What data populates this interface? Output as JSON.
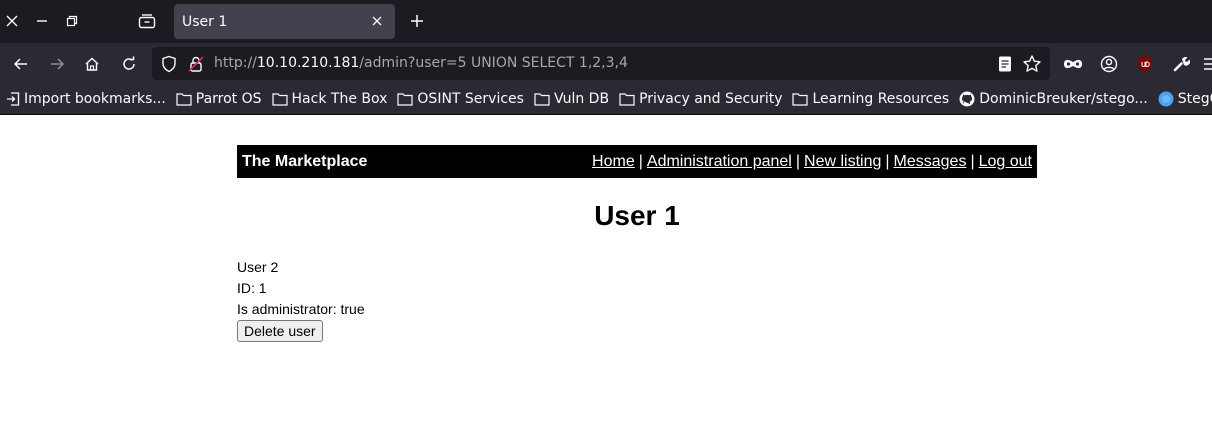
{
  "browser": {
    "tab": {
      "title": "User 1"
    },
    "url": {
      "scheme": "http://",
      "host": "10.10.210.181",
      "rest": "/admin?user=5 UNION SELECT 1,2,3,4"
    },
    "bookmarks": [
      {
        "label": "Import bookmarks...",
        "icon": "import-icon"
      },
      {
        "label": "Parrot OS",
        "icon": "folder-icon"
      },
      {
        "label": "Hack The Box",
        "icon": "folder-icon"
      },
      {
        "label": "OSINT Services",
        "icon": "folder-icon"
      },
      {
        "label": "Vuln DB",
        "icon": "folder-icon"
      },
      {
        "label": "Privacy and Security",
        "icon": "folder-icon"
      },
      {
        "label": "Learning Resources",
        "icon": "folder-icon"
      },
      {
        "label": "DominicBreuker/stego...",
        "icon": "github-icon"
      },
      {
        "label": "StegOnline",
        "icon": "globe-icon"
      }
    ]
  },
  "site": {
    "brand": "The Marketplace",
    "nav": [
      {
        "label": "Home"
      },
      {
        "label": "Administration panel"
      },
      {
        "label": "New listing"
      },
      {
        "label": "Messages"
      },
      {
        "label": "Log out"
      }
    ],
    "separator": "|"
  },
  "page": {
    "heading": "User 1",
    "username": "User 2",
    "id_line": "ID: 1",
    "admin_line": "Is administrator: true",
    "delete_label": "Delete user"
  },
  "colors": {
    "chrome_dark": "#1c1b22",
    "chrome": "#2b2a33",
    "tab_active": "#42414d",
    "header_bg": "#000000"
  }
}
